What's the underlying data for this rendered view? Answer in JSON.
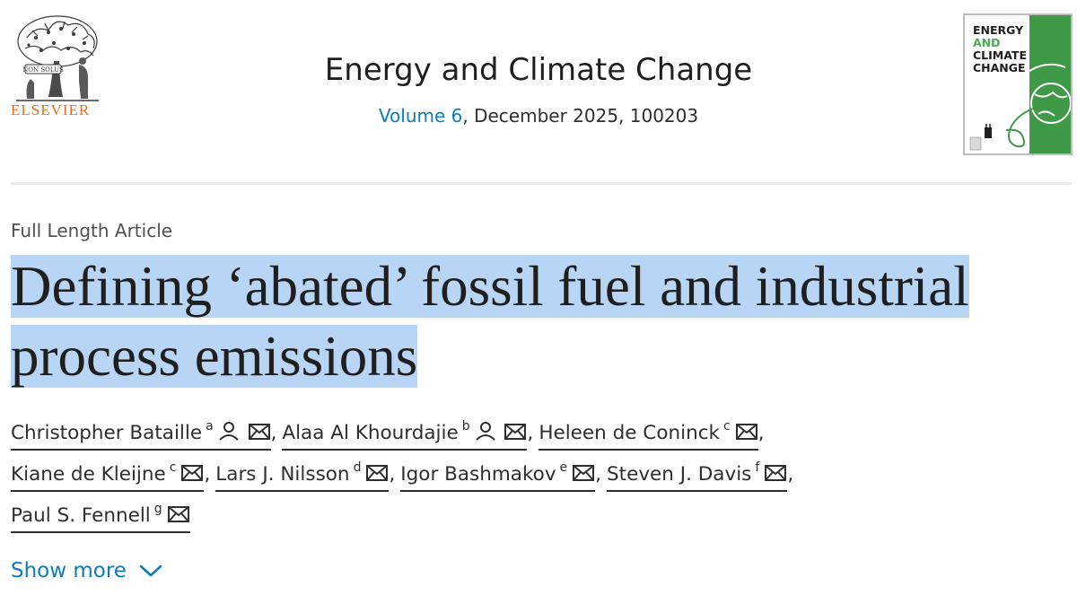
{
  "publisher": {
    "name": "ELSEVIER",
    "emblem_motto": "NON SOLUS"
  },
  "journal": {
    "title": "Energy and Climate Change",
    "volume_link": "Volume 6",
    "issue_rest": ", December 2025, 100203",
    "cover_lines": [
      "ENERGY",
      "AND",
      "CLIMATE",
      "CHANGE"
    ]
  },
  "article": {
    "type": "Full Length Article",
    "title_line1": "Defining ‘abated’ fossil fuel and industrial",
    "title_line2": "process emissions"
  },
  "authors": [
    {
      "name": "Christopher Bataille",
      "aff": "a",
      "person_icon": true,
      "mail_icon": true
    },
    {
      "name": "Alaa Al Khourdajie",
      "aff": "b",
      "person_icon": true,
      "mail_icon": true
    },
    {
      "name": "Heleen de Coninck",
      "aff": "c",
      "person_icon": false,
      "mail_icon": true
    },
    {
      "name": "Kiane de Kleijne",
      "aff": "c",
      "person_icon": false,
      "mail_icon": true
    },
    {
      "name": "Lars J. Nilsson",
      "aff": "d",
      "person_icon": false,
      "mail_icon": true
    },
    {
      "name": "Igor Bashmakov",
      "aff": "e",
      "person_icon": false,
      "mail_icon": true
    },
    {
      "name": "Steven J. Davis",
      "aff": "f",
      "person_icon": false,
      "mail_icon": true
    },
    {
      "name": "Paul S. Fennell",
      "aff": "g",
      "person_icon": false,
      "mail_icon": true
    }
  ],
  "separator": ",",
  "show_more": {
    "label": "Show more",
    "icon": "chevron-down-icon"
  },
  "colors": {
    "link": "#0c7dbb",
    "elsevier_orange": "#e9711c",
    "highlight": "#b9d5f5",
    "cover_green": "#3f9a48"
  }
}
